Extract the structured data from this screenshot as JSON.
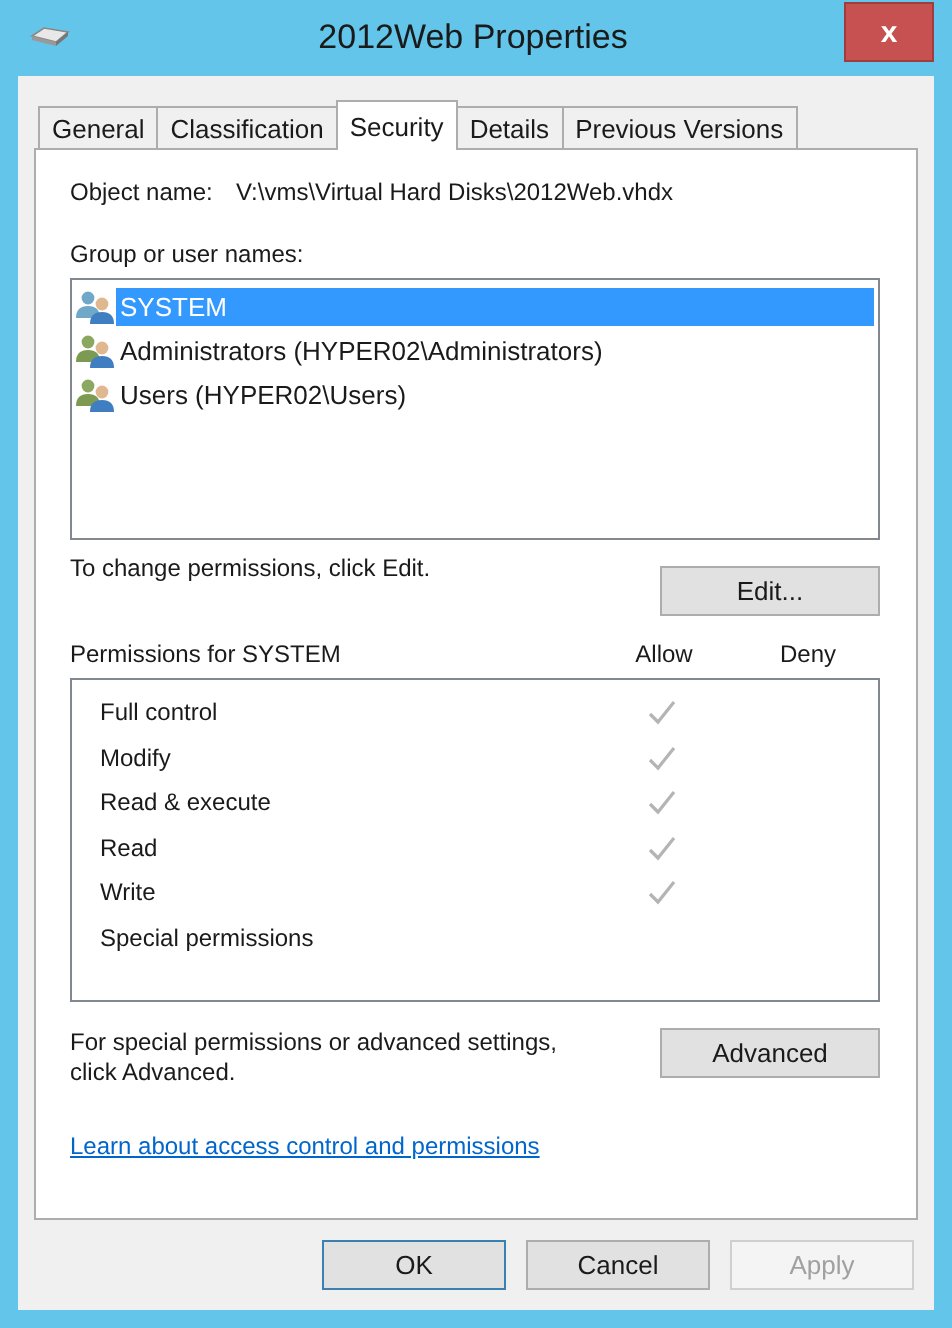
{
  "window": {
    "title": "2012Web Properties",
    "close": "x"
  },
  "tabs": [
    {
      "label": "General",
      "selected": false
    },
    {
      "label": "Classification",
      "selected": false
    },
    {
      "label": "Security",
      "selected": true
    },
    {
      "label": "Details",
      "selected": false
    },
    {
      "label": "Previous Versions",
      "selected": false
    }
  ],
  "object_name": {
    "label": "Object name:",
    "value": "V:\\vms\\Virtual Hard Disks\\2012Web.vhdx"
  },
  "groups": {
    "label": "Group or user names:",
    "items": [
      {
        "name": "SYSTEM",
        "selected": true
      },
      {
        "name": "Administrators (HYPER02\\Administrators)",
        "selected": false
      },
      {
        "name": "Users (HYPER02\\Users)",
        "selected": false
      }
    ]
  },
  "change_hint": "To change permissions, click Edit.",
  "edit_button": "Edit...",
  "permissions": {
    "title": "Permissions for SYSTEM",
    "allow_header": "Allow",
    "deny_header": "Deny",
    "rows": [
      {
        "name": "Full control",
        "allow": true
      },
      {
        "name": "Modify",
        "allow": true
      },
      {
        "name": "Read & execute",
        "allow": true
      },
      {
        "name": "Read",
        "allow": true
      },
      {
        "name": "Write",
        "allow": true
      },
      {
        "name": "Special permissions",
        "allow": false
      }
    ]
  },
  "advanced_hint": "For special permissions or advanced settings, click Advanced.",
  "advanced_button": "Advanced",
  "learn_link": "Learn about access control and permissions",
  "buttons": [
    {
      "label": "OK",
      "disabled": false,
      "default": true
    },
    {
      "label": "Cancel",
      "disabled": false,
      "default": false
    },
    {
      "label": "Apply",
      "disabled": true,
      "default": false
    }
  ]
}
